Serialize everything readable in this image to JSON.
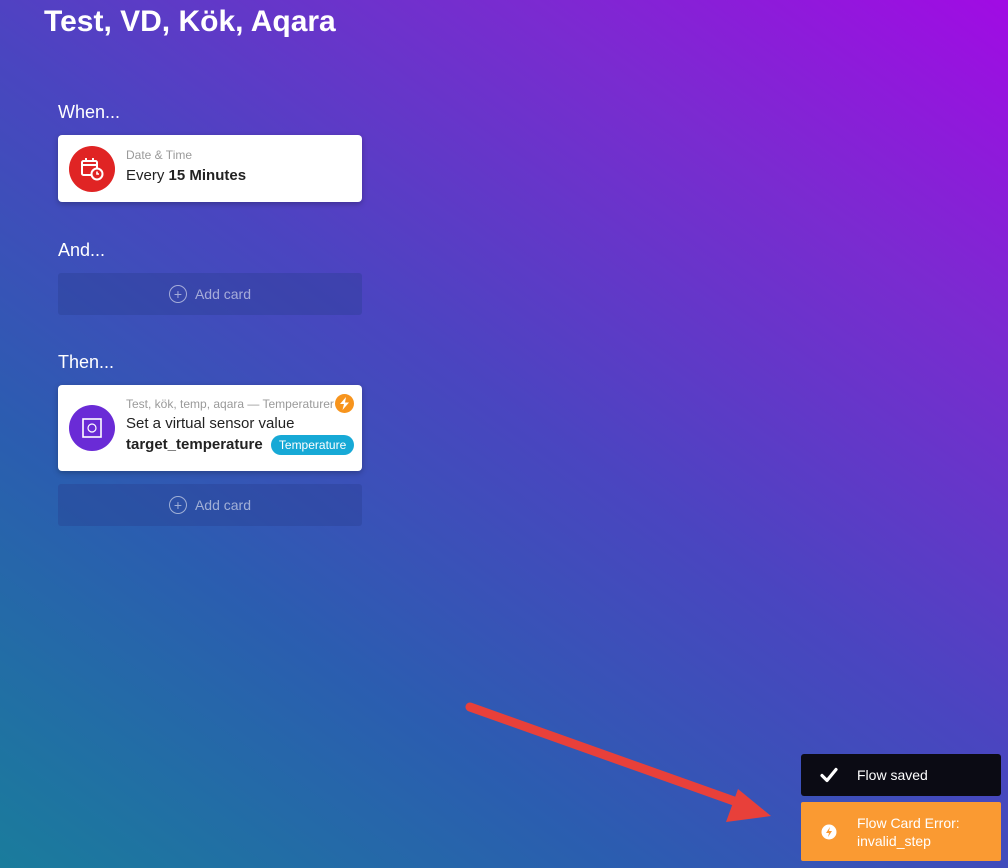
{
  "flow": {
    "title": "Test, VD, Kök, Aqara"
  },
  "sections": {
    "when": "When...",
    "and": "And...",
    "then": "Then..."
  },
  "when_card": {
    "icon": "calendar-clock-icon",
    "subtitle": "Date & Time",
    "text_prefix": "Every",
    "text_bold": "15 Minutes",
    "icon_color": "#e02424"
  },
  "and_add": {
    "label": "Add card"
  },
  "then_card": {
    "icon": "virtual-sensor-icon",
    "subtitle": "Test, kök, temp, aqara — Temperaturer",
    "text": "Set a virtual sensor value",
    "arg": "target_temperature",
    "tag": "Temperature",
    "icon_color": "#6a2bd6",
    "badge_icon": "bolt-icon"
  },
  "then_add": {
    "label": "Add card"
  },
  "toasts": {
    "saved": {
      "icon": "check-icon",
      "text": "Flow saved"
    },
    "error": {
      "icon": "bolt-icon",
      "line1": "Flow Card Error:",
      "line2": "invalid_step"
    }
  },
  "colors": {
    "error_toast": "#fa9a32",
    "saved_toast": "#0b0b14",
    "annotation_arrow": "#e8403a",
    "tag": "#17a9d6"
  }
}
